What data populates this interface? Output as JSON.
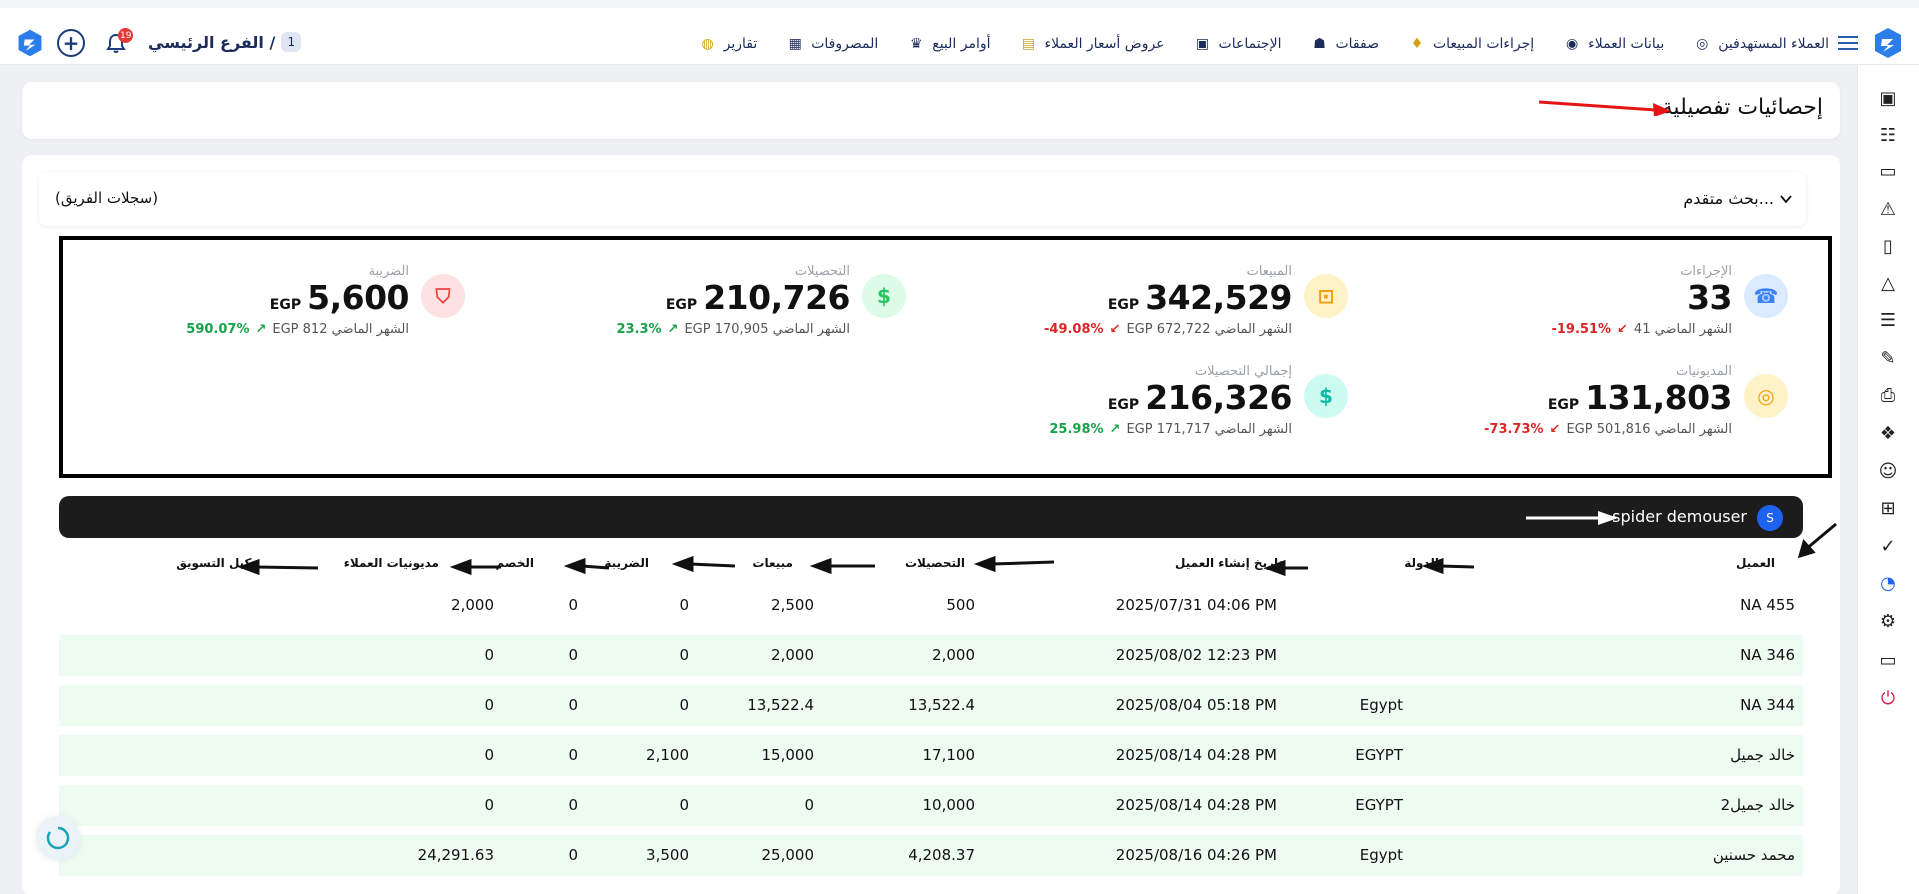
{
  "topbar": {
    "nav": [
      {
        "label": "العملاء المستهدفين",
        "icon": "target-customers-icon"
      },
      {
        "label": "بيانات العملاء",
        "icon": "customer-data-icon"
      },
      {
        "label": "إجراءات المبيعات",
        "icon": "sales-actions-icon"
      },
      {
        "label": "صفقات",
        "icon": "deals-icon"
      },
      {
        "label": "الإجتماعات",
        "icon": "meetings-icon"
      },
      {
        "label": "عروض أسعار العملاء",
        "icon": "quotes-icon"
      },
      {
        "label": "أوامر البيع",
        "icon": "sales-orders-icon"
      },
      {
        "label": "المصروفات",
        "icon": "expenses-icon"
      },
      {
        "label": "تقارير",
        "icon": "reports-icon"
      }
    ],
    "branch_label": "الفرع الرئيسي /",
    "branch_count": "1",
    "notifications_count": "19"
  },
  "page": {
    "title": "إحصائيات تفصيلية"
  },
  "search": {
    "toggle_label": "بحث متقدم...",
    "scope": "(سجلات الفريق)"
  },
  "stats": [
    {
      "label": "الإجراءات",
      "value": "33",
      "currency": "",
      "prev": "41 الشهر الماضي",
      "change": "-19.51%",
      "direction": "down",
      "icon": "phone-icon",
      "color": "#3b82f6"
    },
    {
      "label": "المبيعات",
      "value": "342,529",
      "currency": "EGP",
      "prev": "EGP 672,722 الشهر الماضي",
      "change": "-49.08%",
      "direction": "down",
      "icon": "sales-icon",
      "color": "#f59e0b"
    },
    {
      "label": "التحصيلات",
      "value": "210,726",
      "currency": "EGP",
      "prev": "EGP 170,905 الشهر الماضي",
      "change": "23.3%",
      "direction": "up",
      "icon": "collections-icon",
      "color": "#22c55e"
    },
    {
      "label": "الضريبة",
      "value": "5,600",
      "currency": "EGP",
      "prev": "EGP 812 الشهر الماضي",
      "change": "590.07%",
      "direction": "up",
      "icon": "tax-icon",
      "color": "#ef4444"
    },
    {
      "label": "المديونيات",
      "value": "131,803",
      "currency": "EGP",
      "prev": "EGP 501,816 الشهر الماضي",
      "change": "-73.73%",
      "direction": "down",
      "icon": "coins-icon",
      "color": "#f59e0b"
    },
    {
      "label": "إجمالي التحصيلات",
      "value": "216,326",
      "currency": "EGP",
      "prev": "EGP 171,717 الشهر الماضي",
      "change": "25.98%",
      "direction": "up",
      "icon": "total-collections-icon",
      "color": "#14b8a6"
    }
  ],
  "user": {
    "initial": "S",
    "name": "spider demouser"
  },
  "table": {
    "columns": [
      "العميل",
      "الدولة",
      "تاريخ إنشاء العميل",
      "التحصيلات",
      "مبيعات",
      "الضريبة",
      "الخصم",
      "مديونيات العملاء",
      "وكيل التسويق"
    ],
    "rows": [
      [
        "NA 455",
        "",
        "2025/07/31 04:06 PM",
        "500",
        "2,500",
        "0",
        "0",
        "2,000",
        ""
      ],
      [
        "NA 346",
        "",
        "2025/08/02 12:23 PM",
        "2,000",
        "2,000",
        "0",
        "0",
        "0",
        ""
      ],
      [
        "NA 344",
        "Egypt",
        "2025/08/04 05:18 PM",
        "13,522.4",
        "13,522.4",
        "0",
        "0",
        "0",
        ""
      ],
      [
        "خالد جميل",
        "EGYPT",
        "2025/08/14 04:28 PM",
        "17,100",
        "15,000",
        "2,100",
        "0",
        "0",
        ""
      ],
      [
        "خالد جميل2",
        "EGYPT",
        "2025/08/14 04:28 PM",
        "10,000",
        "0",
        "0",
        "0",
        "0",
        ""
      ],
      [
        "محمد حسنين",
        "Egypt",
        "2025/08/16 04:26 PM",
        "4,208.37",
        "25,000",
        "3,500",
        "0",
        "24,291.63",
        ""
      ]
    ]
  },
  "sidebar": {
    "icons": [
      "dashboard-icon",
      "team-icon",
      "money-icon",
      "warning-icon",
      "device-icon",
      "triangle-icon",
      "invoice-icon",
      "signature-icon",
      "print-icon",
      "gift-icon",
      "user-settings-icon",
      "document-add-icon",
      "document-check-icon",
      "analytics-icon",
      "settings-icon",
      "window-icon",
      "power-icon"
    ]
  }
}
